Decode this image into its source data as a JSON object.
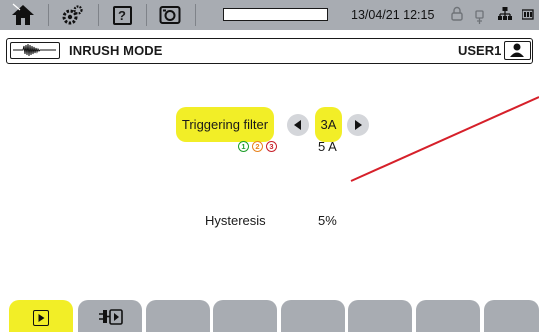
{
  "status_bar": {
    "icons": [
      "home-icon",
      "settings-gears-icon",
      "help-icon",
      "camera-icon",
      "progress-bar",
      "lock-icon",
      "usb-icon",
      "network-icon",
      "battery-icon"
    ],
    "help_label": "?",
    "progress": 0,
    "datetime": "13/04/21 12:15"
  },
  "title_bar": {
    "mode_icon": "inrush-waveform-icon",
    "title": "INRUSH MODE",
    "user": "USER1",
    "user_icon": "user-icon"
  },
  "main": {
    "triggering_filter_label": "Triggering filter",
    "triggering_filter_value": "3A",
    "phases": [
      {
        "label": "1",
        "color": "#1e9e2a"
      },
      {
        "label": "2",
        "color": "#e8841f"
      },
      {
        "label": "3",
        "color": "#c8212b"
      }
    ],
    "threshold_value": "5 A",
    "hysteresis_label": "Hysteresis",
    "hysteresis_value": "5%",
    "annotation_line_color": "#d6202a"
  },
  "tabs": {
    "items": [
      {
        "icon": "play-icon",
        "active": true
      },
      {
        "icon": "plug-play-icon",
        "active": false
      },
      {
        "icon": "",
        "active": false
      },
      {
        "icon": "",
        "active": false
      },
      {
        "icon": "",
        "active": false
      },
      {
        "icon": "",
        "active": false
      },
      {
        "icon": "",
        "active": false
      },
      {
        "icon": "",
        "active": false
      }
    ]
  }
}
